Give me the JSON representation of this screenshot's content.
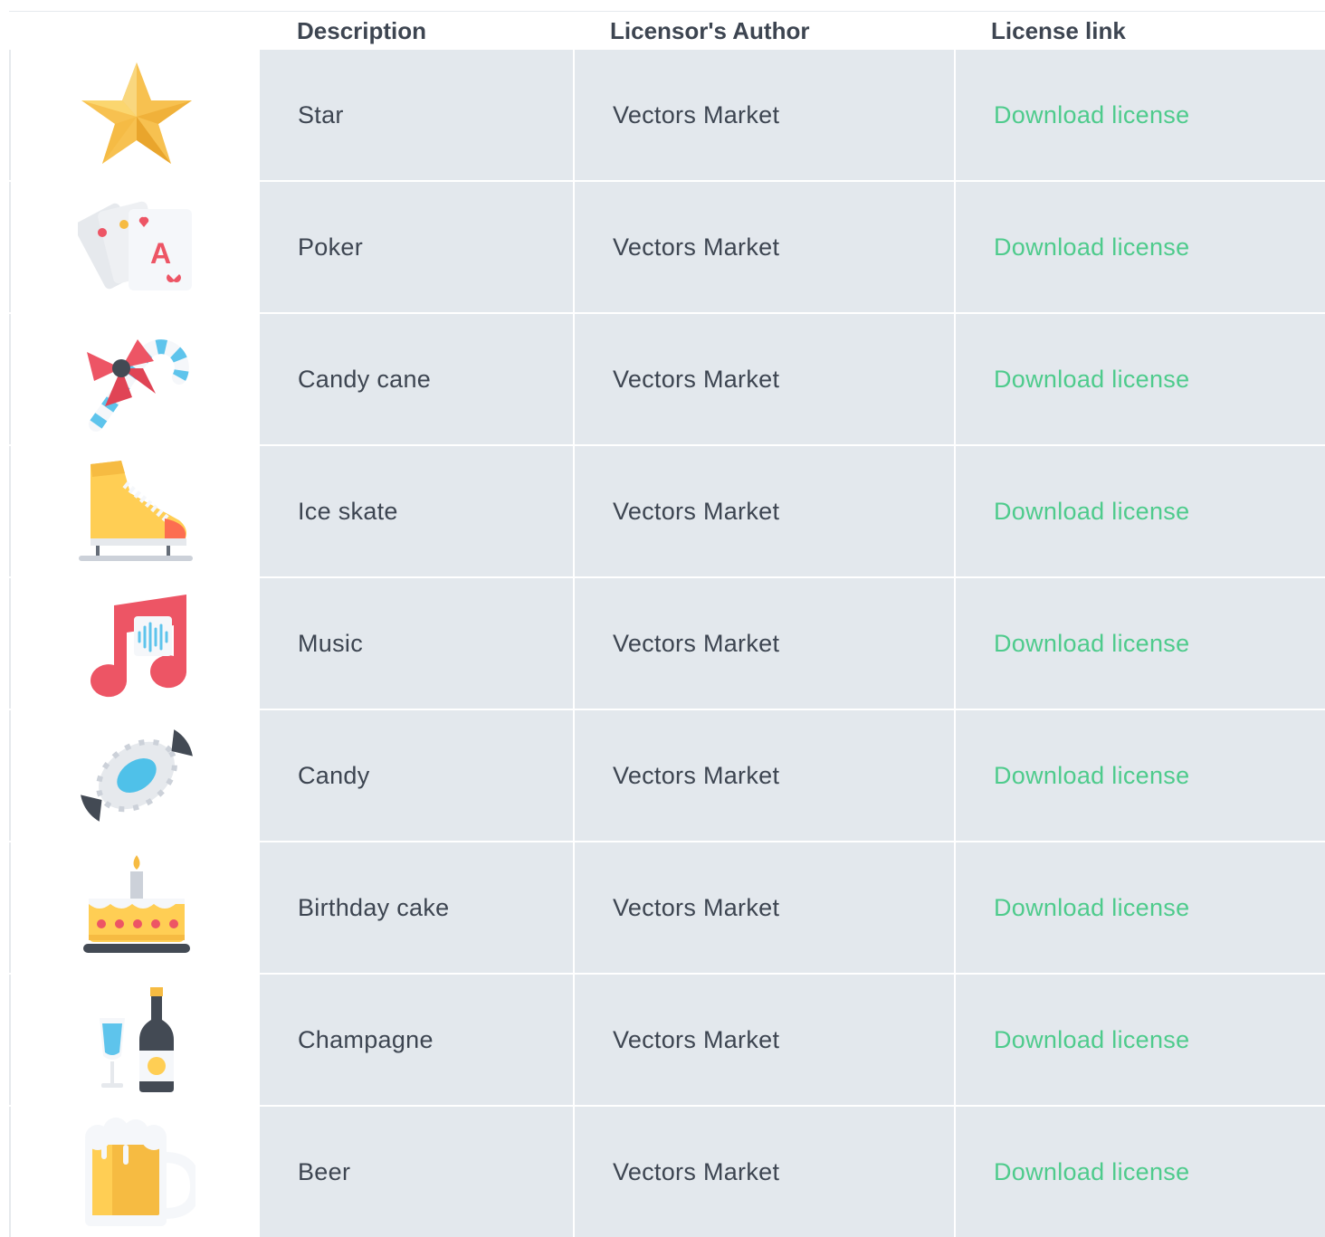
{
  "table": {
    "headers": {
      "icon": "",
      "description": "Description",
      "author": "Licensor's Author",
      "license": "License link"
    },
    "rows": [
      {
        "icon": "star-icon",
        "description": "Star",
        "author": "Vectors Market",
        "license": "Download license"
      },
      {
        "icon": "poker-cards-icon",
        "description": "Poker",
        "author": "Vectors Market",
        "license": "Download license"
      },
      {
        "icon": "candy-cane-icon",
        "description": "Candy cane",
        "author": "Vectors Market",
        "license": "Download license"
      },
      {
        "icon": "ice-skate-icon",
        "description": "Ice skate",
        "author": "Vectors Market",
        "license": "Download license"
      },
      {
        "icon": "music-note-icon",
        "description": "Music",
        "author": "Vectors Market",
        "license": "Download license"
      },
      {
        "icon": "candy-icon",
        "description": "Candy",
        "author": "Vectors Market",
        "license": "Download license"
      },
      {
        "icon": "birthday-cake-icon",
        "description": "Birthday cake",
        "author": "Vectors Market",
        "license": "Download license"
      },
      {
        "icon": "champagne-icon",
        "description": "Champagne",
        "author": "Vectors Market",
        "license": "Download license"
      },
      {
        "icon": "beer-icon",
        "description": "Beer",
        "author": "Vectors Market",
        "license": "Download license"
      }
    ]
  },
  "colors": {
    "header_text": "#3d4551",
    "body_text": "#3d4551",
    "link": "#4ecb8c",
    "cell_background": "#e3e8ed",
    "icon_cell_background": "#ffffff",
    "border": "#e6e9ed"
  }
}
